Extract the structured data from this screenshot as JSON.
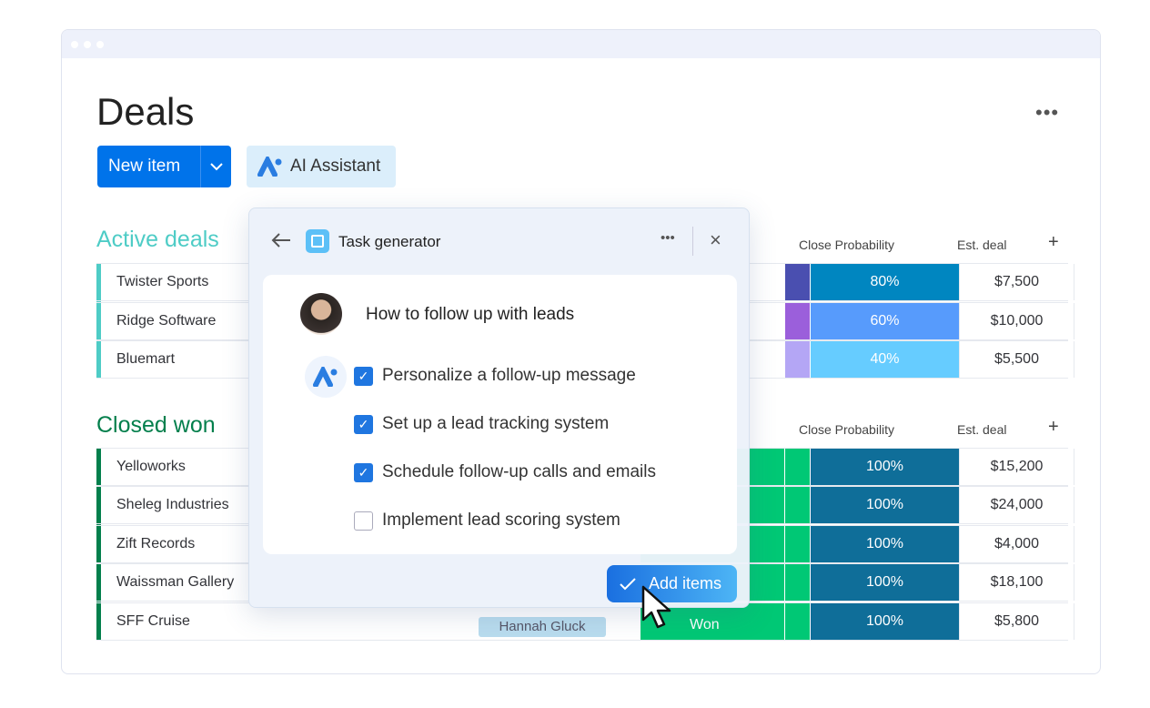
{
  "board": {
    "title": "Deals",
    "new_item": "New item",
    "ai_assistant": "AI Assistant"
  },
  "columns": {
    "close_probability": "Close Probability",
    "est_deal": "Est. deal",
    "add": "+"
  },
  "active": {
    "title": "Active deals",
    "color": "#4eccc6",
    "rows": [
      {
        "name": "Twister Sports",
        "strip": "#4a4fb0",
        "prob": "80%",
        "prob_color": "#0086c0",
        "est": "$7,500"
      },
      {
        "name": "Ridge Software",
        "strip": "#9b5fdb",
        "prob": "60%",
        "prob_color": "#579bfc",
        "est": "$10,000"
      },
      {
        "name": "Bluemart",
        "strip": "#b4a6f5",
        "prob": "40%",
        "prob_color": "#66ccff",
        "est": "$5,500"
      }
    ]
  },
  "closed": {
    "title": "Closed won",
    "color": "#037f4c",
    "rows": [
      {
        "name": "Yelloworks",
        "prob": "100%",
        "est": "$15,200"
      },
      {
        "name": "Sheleg Industries",
        "prob": "100%",
        "est": "$24,000"
      },
      {
        "name": "Zift Records",
        "prob": "100%",
        "est": "$4,000"
      },
      {
        "name": "Waissman Gallery",
        "prob": "100%",
        "est": "$18,100"
      },
      {
        "name": "SFF Cruise",
        "prob": "100%",
        "est": "$5,800",
        "owner": "Hannah Gluck",
        "status": "Won"
      }
    ]
  },
  "popup": {
    "title": "Task generator",
    "prompt": "How to follow up with leads",
    "tasks": [
      {
        "label": "Personalize a follow-up message",
        "checked": true
      },
      {
        "label": "Set up a lead tracking system",
        "checked": true
      },
      {
        "label": "Schedule follow-up calls and emails",
        "checked": true
      },
      {
        "label": "Implement lead scoring system",
        "checked": false
      }
    ],
    "add_items": "Add items"
  }
}
